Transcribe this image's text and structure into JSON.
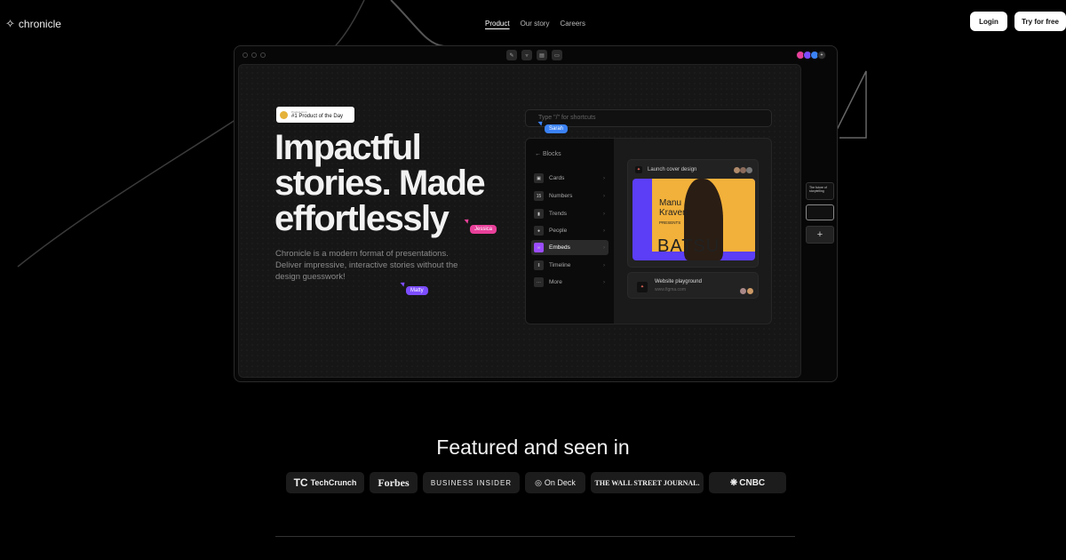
{
  "nav": {
    "logo_text": "chronicle",
    "links": [
      "Product",
      "Our story",
      "Careers"
    ],
    "active": "Product",
    "login": "Login",
    "try_free": "Try for free"
  },
  "hero": {
    "badge_small": "Product Hunt",
    "badge_title": "#1 Product of the Day",
    "headline_1": "Impactful",
    "headline_2": "stories. Made",
    "headline_3": "effortlessly",
    "description": "Chronicle is a modern format of presentations. Deliver impressive, interactive stories without the design guesswork!",
    "cursor_jessica": "Jessica",
    "cursor_matty": "Matty",
    "cursor_sarah": "Sarah"
  },
  "editor": {
    "command_placeholder": "Type \"/\" for shortcuts",
    "blocks_header": "Blocks",
    "block_items": [
      "Cards",
      "Numbers",
      "Trends",
      "People",
      "Embeds",
      "Timeline",
      "More"
    ],
    "active_block": "Embeds",
    "card1_title": "Launch cover design",
    "poster_name_1": "Manu",
    "poster_name_2": "Kraven",
    "poster_presents": "PRESENTS",
    "poster_big": "BATSU",
    "card2_title": "Website playground",
    "card2_url": "www.figma.com",
    "slide_thumb_title": "The future of storytelling",
    "add_slide": "+"
  },
  "featured": {
    "heading": "Featured and seen in",
    "logos": [
      "TechCrunch",
      "Forbes",
      "BUSINESS INSIDER",
      "On Deck",
      "THE WALL STREET JOURNAL.",
      "CNBC"
    ]
  },
  "colors": {
    "accent_purple": "#9b4dff",
    "cursor_pink": "#e8409a",
    "cursor_blue": "#3b82f6",
    "cursor_violet": "#7c4dff",
    "poster_yellow": "#f2b13a",
    "poster_blue": "#5b3ef6"
  }
}
